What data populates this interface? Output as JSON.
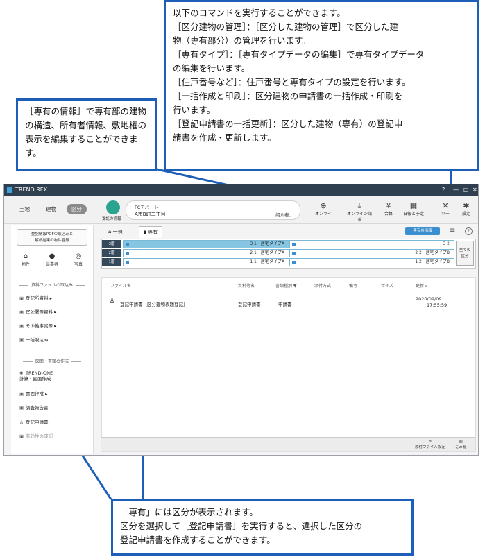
{
  "callouts": {
    "top": [
      "以下のコマンドを実行することができます。",
      "［区分建物の管理］：［区分した建物の管理］で区分した建",
      "物（専有部分）の管理を行います。",
      "［専有タイプ］：［専有タイプデータの編集］で専有タイプデータ",
      "の編集を行います。",
      "［住戸番号など］：住戸番号と専有タイプの設定を行います。",
      "［一括作成と印刷］：区分建物の申請書の一括作成・印刷を",
      "行います。",
      "［登記申請書の一括更新］：区分した建物（専有）の登記申",
      "請書を作成・更新します。"
    ],
    "left": "［専有の情報］で専有部の建物の構造、所有者情報、敷地権の表示を編集することができます。",
    "bottom": [
      "「専有」には区分が表示されます。",
      "区分を選択して［登記申請書］を実行すると、選択した区分の",
      "登記申請書を作成することができます。"
    ]
  },
  "app": {
    "title": "TREND REX",
    "controls": [
      "?",
      "—",
      "□",
      "✕"
    ],
    "segments": [
      "土地",
      "建物",
      "区分"
    ],
    "received_label": "受託の情報",
    "property_name": "FCアパート",
    "property_address": "A市B町二丁目",
    "introducer": "紹介者：",
    "toolbar": [
      {
        "icon": "globe-icon",
        "label": "オンライ"
      },
      {
        "icon": "download-icon",
        "label": "オンライン請求"
      },
      {
        "icon": "yen-icon",
        "label": "合算"
      },
      {
        "icon": "calendar-icon",
        "label": "日報と予定"
      },
      {
        "icon": "tools-icon",
        "label": "ツー"
      },
      {
        "icon": "gear-icon",
        "label": "設定"
      }
    ]
  },
  "sidebar": {
    "import_button": "登記情報PDFの取込みと\n解析結果の物件登録",
    "icons": [
      "物件",
      "当事者",
      "写真"
    ],
    "section1": "資料ファイルの取込み",
    "items1": [
      "登記所資料",
      "官公署等資料",
      "その他事実等",
      "一括取込み"
    ],
    "section2": "図面・書類の作成",
    "trend_one": "TREND-ONE\n計算・図面作成",
    "items2": [
      "書面作成",
      "調査報告書",
      "登記申請書",
      "有効性の確認"
    ]
  },
  "main": {
    "tabs": [
      "一棟",
      "専有"
    ],
    "info_button": "専有の情報",
    "units": [
      {
        "floor": "3階",
        "a_num": "3 1",
        "a_type": "居宅タイプA",
        "b_num": "3 2",
        "b_type": ""
      },
      {
        "floor": "2階",
        "a_num": "2 1",
        "a_type": "居宅タイプA",
        "b_num": "2 2",
        "b_type": "居宅タイプB"
      },
      {
        "floor": "1階",
        "a_num": "1 1",
        "a_type": "居宅タイプA",
        "b_num": "1 2",
        "b_type": "居宅タイプB"
      }
    ],
    "all_button": "全ての\n区分",
    "columns": [
      "ファイル名",
      "資料等名",
      "書類種別 ▼",
      "添付方式",
      "備考",
      "サイズ",
      "更新日"
    ],
    "row": {
      "file": "登記申請書［区分建物表題登記］",
      "doc": "登記申請書",
      "kind": "申請書",
      "date": "2020/09/09",
      "time": "17:55:59"
    },
    "bottom_buttons": [
      "添付ファイル設定",
      "ごみ箱"
    ]
  },
  "colors": {
    "callout_border": "#1d5fb8",
    "accent": "#3c8fce",
    "titlebar": "#2f3f4f"
  }
}
